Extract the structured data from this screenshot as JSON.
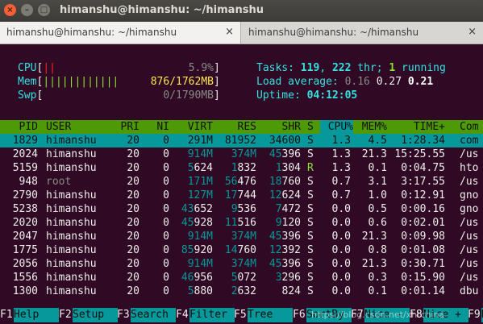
{
  "window": {
    "title": "himanshu@himanshu: ~/himanshu",
    "close_glyph": "×",
    "min_glyph": "–",
    "max_glyph": "□"
  },
  "tabs": [
    {
      "label": "himanshu@himanshu: ~/himanshu",
      "close": "×",
      "active": true
    },
    {
      "label": "himanshu@himanshu: ~/himanshu",
      "close": "×",
      "active": false
    }
  ],
  "meters": {
    "cpu": {
      "label": "CPU",
      "bars": "||",
      "value": "5.9%"
    },
    "mem": {
      "label": "Mem",
      "bars": "||||||||||||",
      "value": "876/1762MB"
    },
    "swp": {
      "label": "Swp",
      "bars": "",
      "value": "0/1790MB"
    }
  },
  "summary": {
    "tasks_label": "Tasks: ",
    "tasks": "119",
    "thr": "222",
    "thr_suffix": " thr; ",
    "running": "1",
    "running_suffix": " running",
    "load_label": "Load average: ",
    "load1": "0.16",
    "load5": "0.27",
    "load15": "0.21",
    "uptime_label": "Uptime: ",
    "uptime": "04:12:05"
  },
  "columns": [
    "PID",
    "USER",
    "PRI",
    "NI",
    "VIRT",
    "RES",
    "SHR",
    "S",
    "CPU%",
    "MEM%",
    "TIME+",
    "Com"
  ],
  "rows": [
    [
      "1829",
      "himanshu",
      "20",
      "0",
      "291M",
      "81952",
      "34600",
      "S",
      "1.3",
      "4.5",
      "1:28.34",
      "com"
    ],
    [
      "2024",
      "himanshu",
      "20",
      "0",
      "914M",
      "374M",
      "45396",
      "S",
      "1.3",
      "21.3",
      "15:25.55",
      "/us"
    ],
    [
      "5159",
      "himanshu",
      "20",
      "0",
      "5624",
      "1832",
      "1304",
      "R",
      "1.3",
      "0.1",
      "0:04.75",
      "hto"
    ],
    [
      "948",
      "root",
      "20",
      "0",
      "171M",
      "56476",
      "18760",
      "S",
      "0.7",
      "3.1",
      "3:17.55",
      "/us"
    ],
    [
      "2790",
      "himanshu",
      "20",
      "0",
      "127M",
      "17744",
      "12624",
      "S",
      "0.7",
      "1.0",
      "0:12.91",
      "gno"
    ],
    [
      "5238",
      "himanshu",
      "20",
      "0",
      "43652",
      "9536",
      "7472",
      "S",
      "0.0",
      "0.5",
      "0:00.16",
      "gno"
    ],
    [
      "2020",
      "himanshu",
      "20",
      "0",
      "45928",
      "11516",
      "9120",
      "S",
      "0.0",
      "0.6",
      "0:02.01",
      "/us"
    ],
    [
      "2047",
      "himanshu",
      "20",
      "0",
      "914M",
      "374M",
      "45396",
      "S",
      "0.0",
      "21.3",
      "0:09.98",
      "/us"
    ],
    [
      "1775",
      "himanshu",
      "20",
      "0",
      "85920",
      "14760",
      "12392",
      "S",
      "0.0",
      "0.8",
      "0:01.08",
      "/us"
    ],
    [
      "2056",
      "himanshu",
      "20",
      "0",
      "914M",
      "374M",
      "45396",
      "S",
      "0.0",
      "21.3",
      "0:30.71",
      "/us"
    ],
    [
      "1556",
      "himanshu",
      "20",
      "0",
      "46956",
      "5072",
      "3296",
      "S",
      "0.0",
      "0.3",
      "0:15.90",
      "/us"
    ],
    [
      "1300",
      "himanshu",
      "20",
      "0",
      "5880",
      "2632",
      "824",
      "S",
      "0.0",
      "0.1",
      "0:01.14",
      "dbu"
    ]
  ],
  "fkeys": [
    {
      "key": "F1",
      "label": "Help"
    },
    {
      "key": "F2",
      "label": "Setup"
    },
    {
      "key": "F3",
      "label": "Search"
    },
    {
      "key": "F4",
      "label": "Filter"
    },
    {
      "key": "F5",
      "label": "Tree"
    },
    {
      "key": "F6",
      "label": "SortBy"
    },
    {
      "key": "F7",
      "label": "Nice -"
    },
    {
      "key": "F8",
      "label": "Nice +"
    },
    {
      "key": "F9",
      "label": "Kill"
    }
  ],
  "watermark": "https://blog.csdn.net/xhtchina",
  "colors": {
    "terminal_bg": "#300a24",
    "header_bg": "#4e9a06",
    "selection_bg": "#06989a",
    "accent_cyan": "#34e2e2"
  }
}
